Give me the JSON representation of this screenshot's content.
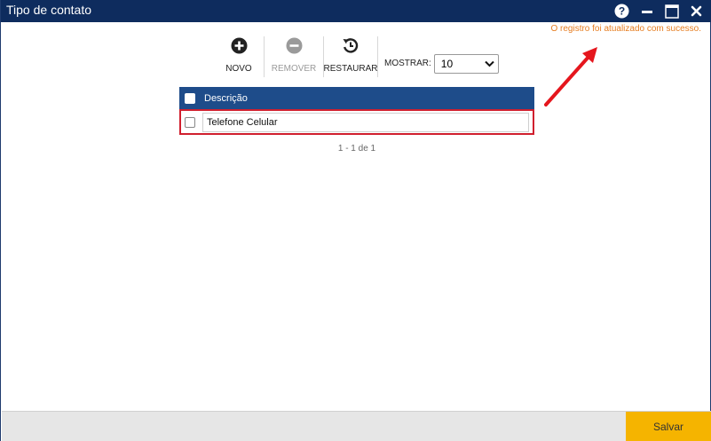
{
  "window": {
    "title": "Tipo de contato",
    "icons": [
      "help-icon",
      "minimize-icon",
      "maximize-icon",
      "close-icon"
    ]
  },
  "message": {
    "text": "O registro foi atualizado com sucesso.",
    "color": "#e67e22"
  },
  "toolbar": {
    "new_label": "NOVO",
    "remove_label": "REMOVER",
    "restore_label": "RESTAURAR",
    "show_label": "MOSTRAR:",
    "show_value": "10"
  },
  "grid": {
    "header": "Descrição",
    "rows": [
      {
        "description": "Telefone Celular"
      }
    ],
    "pagination": "1 - 1 de 1"
  },
  "footer": {
    "save_label": "Salvar"
  },
  "colors": {
    "titlebar": "#0e2c5e",
    "grid_header": "#1e4c8a",
    "highlight": "#d01f2e",
    "save_button": "#f5b400"
  }
}
